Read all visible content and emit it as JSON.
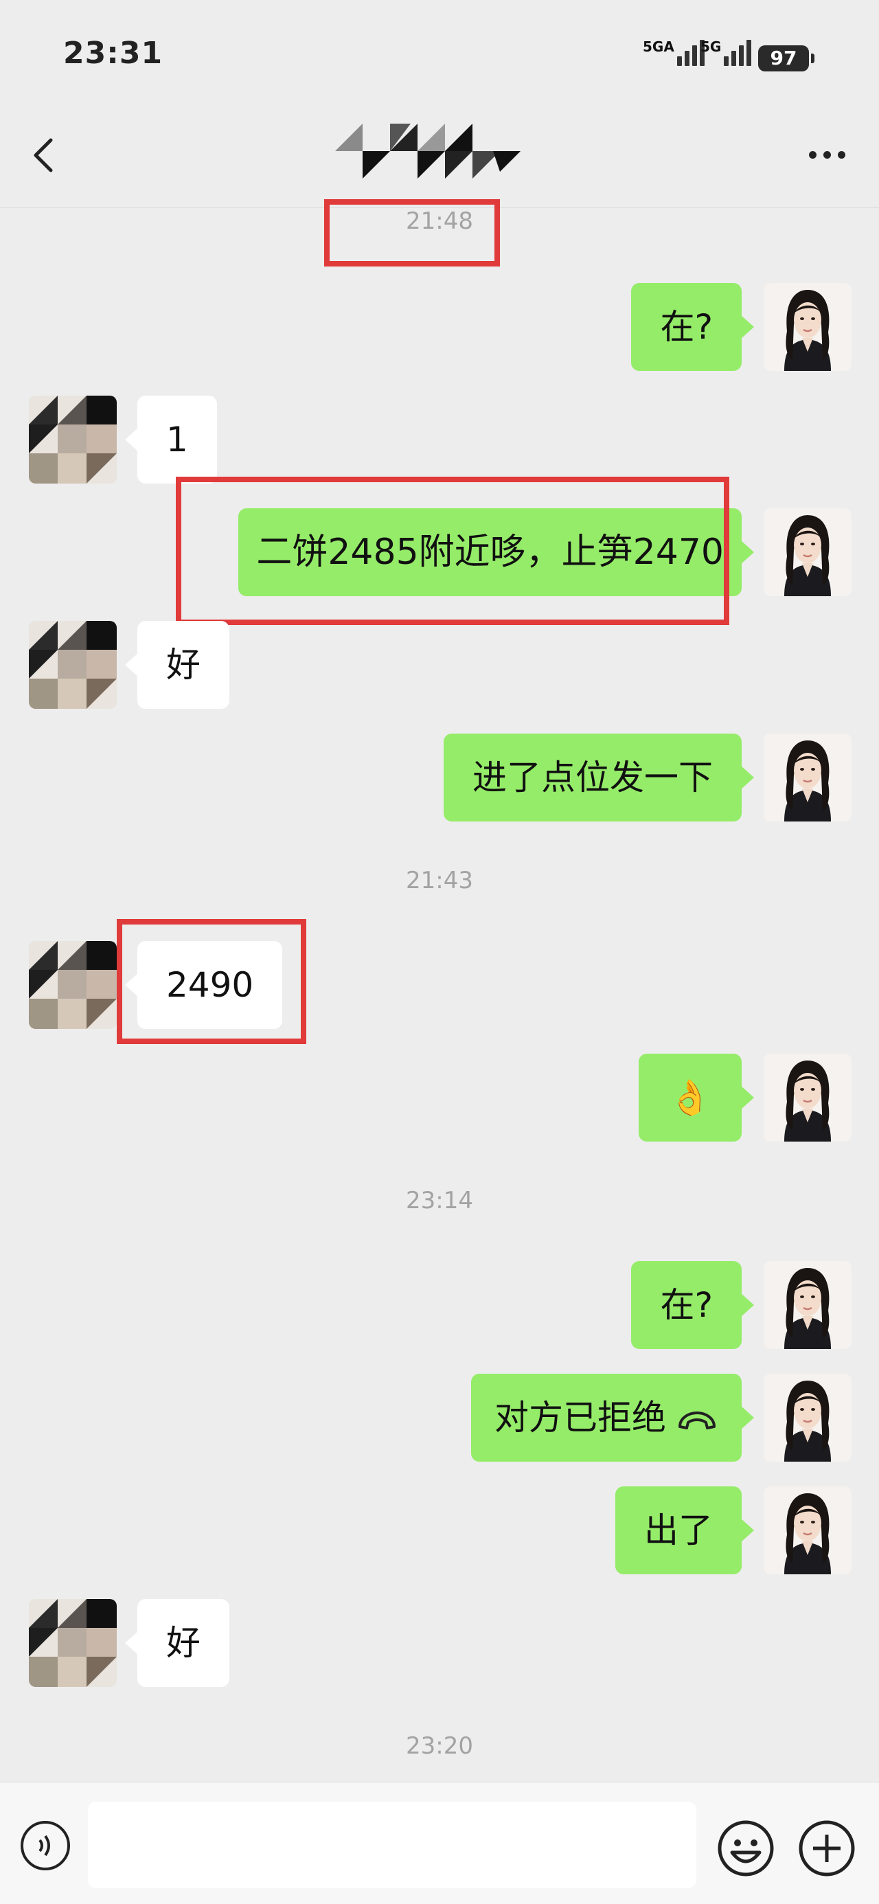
{
  "status_bar": {
    "time": "23:31",
    "signal1_label": "5GA",
    "signal2_label": "5G",
    "battery": "97"
  },
  "header": {
    "back_icon": "chevron-left-icon",
    "more_icon": "ellipsis-icon",
    "title_note": ""
  },
  "messages": [
    {
      "type": "timestamp",
      "text": "21:48"
    },
    {
      "type": "sent",
      "text": "在?"
    },
    {
      "type": "received",
      "text": "1"
    },
    {
      "type": "sent",
      "text": "二饼2485附近哆，止笋2470"
    },
    {
      "type": "received",
      "text": "好"
    },
    {
      "type": "sent",
      "text": "进了点位发一下"
    },
    {
      "type": "timestamp",
      "text": "21:43"
    },
    {
      "type": "received",
      "text": "2490"
    },
    {
      "type": "sent",
      "text": "👌"
    },
    {
      "type": "timestamp",
      "text": "23:14"
    },
    {
      "type": "sent",
      "text": "在?"
    },
    {
      "type": "sent",
      "text": "对方已拒绝",
      "icon": "phone-hangup-icon"
    },
    {
      "type": "sent",
      "text": "出了"
    },
    {
      "type": "received",
      "text": "好"
    },
    {
      "type": "timestamp",
      "text": "23:20"
    }
  ],
  "input_bar": {
    "placeholder": "",
    "voice_icon": "voice-icon",
    "emoji_icon": "emoji-icon",
    "plus_icon": "plus-icon"
  },
  "colors": {
    "background": "#ededed",
    "sent_bubble": "#95ec69",
    "received_bubble": "#ffffff",
    "highlight_box": "#e03a3a"
  }
}
